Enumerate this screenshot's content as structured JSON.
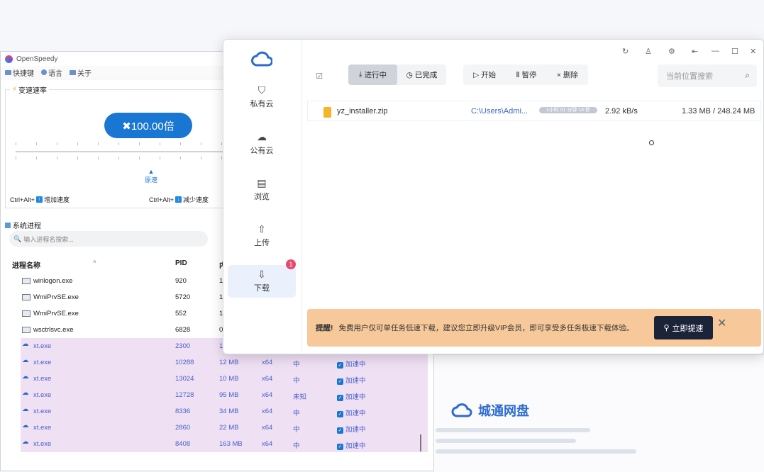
{
  "background": {
    "brand_name": "城通网盘"
  },
  "openspeedy": {
    "title": "OpenSpeedy",
    "menu": [
      {
        "label": "快捷键",
        "icon": "keyboard-icon"
      },
      {
        "label": "语言",
        "icon": "globe-icon"
      },
      {
        "label": "关于",
        "icon": "book-icon"
      }
    ],
    "speed_group_title": "变速速率",
    "speed_value": "✖100.00倍",
    "origin_label": "原速",
    "hotkey_increase": {
      "prefix": "Ctrl+Alt+",
      "key": "↑",
      "label": "增加速度"
    },
    "hotkey_decrease": {
      "prefix": "Ctrl+Alt+",
      "key": "↓",
      "label": "减少速度"
    },
    "process_group_title": "系统进程",
    "search_placeholder": "输入进程名搜索...",
    "columns": {
      "name": "进程名称",
      "pid": "PID",
      "mem": "内"
    },
    "processes": [
      {
        "name": "winlogon.exe",
        "pid": "920",
        "mem": "1",
        "arch": "",
        "prio": "",
        "accel": ""
      },
      {
        "name": "WmiPrvSE.exe",
        "pid": "5720",
        "mem": "1",
        "arch": "",
        "prio": "",
        "accel": ""
      },
      {
        "name": "WmiPrvSE.exe",
        "pid": "552",
        "mem": "1",
        "arch": "",
        "prio": "",
        "accel": ""
      },
      {
        "name": "wsctrlsvc.exe",
        "pid": "6828",
        "mem": "0",
        "arch": "",
        "prio": "",
        "accel": ""
      },
      {
        "name": "xt.exe",
        "pid": "2300",
        "mem": "1",
        "arch": "",
        "prio": "",
        "accel": ""
      },
      {
        "name": "xt.exe",
        "pid": "10288",
        "mem": "12 MB",
        "arch": "x64",
        "prio": "中",
        "accel": "加速中"
      },
      {
        "name": "xt.exe",
        "pid": "13024",
        "mem": "10 MB",
        "arch": "x64",
        "prio": "中",
        "accel": "加速中"
      },
      {
        "name": "xt.exe",
        "pid": "12728",
        "mem": "95 MB",
        "arch": "x64",
        "prio": "未知",
        "accel": "加速中"
      },
      {
        "name": "xt.exe",
        "pid": "8336",
        "mem": "34 MB",
        "arch": "x64",
        "prio": "中",
        "accel": "加速中"
      },
      {
        "name": "xt.exe",
        "pid": "2860",
        "mem": "22 MB",
        "arch": "x64",
        "prio": "中",
        "accel": "加速中"
      },
      {
        "name": "xt.exe",
        "pid": "8408",
        "mem": "163 MB",
        "arch": "x64",
        "prio": "中",
        "accel": "加速中"
      }
    ]
  },
  "downloader": {
    "nav": [
      {
        "label": "私有云",
        "icon": "shield-icon"
      },
      {
        "label": "公有云",
        "icon": "cloud-icon"
      },
      {
        "label": "浏览",
        "icon": "folder-icon"
      },
      {
        "label": "上传",
        "icon": "upload-icon"
      },
      {
        "label": "下载",
        "icon": "download-icon"
      }
    ],
    "download_badge": "1",
    "tabs": {
      "active": "进行中",
      "done": "已完成"
    },
    "actions": {
      "start": "开始",
      "pause": "暂停",
      "delete": "删除"
    },
    "search_placeholder": "当前位置搜索",
    "file": {
      "name": "yz_installer.zip",
      "path": "C:\\Users\\Admi...",
      "progress_text": "1小时 01 分钟 14 秒",
      "speed": "2.92 kB/s",
      "size": "1.33 MB / 248.24 MB"
    },
    "promo": {
      "title": "提醒!",
      "text": "免费用户仅可单任务低速下载，建议您立即升级VIP会员，即可享受多任务极速下载体验。",
      "button": "立即提速"
    }
  }
}
